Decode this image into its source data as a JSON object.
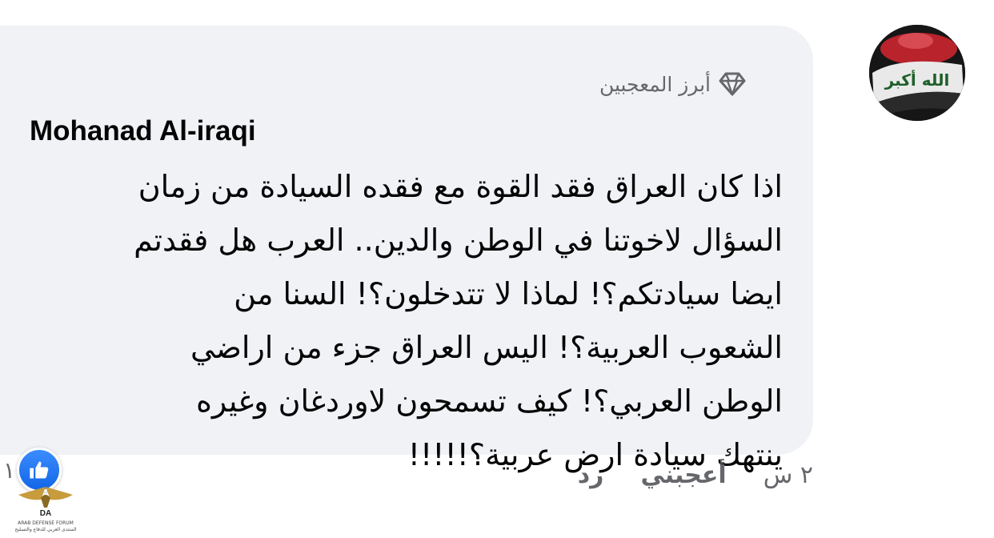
{
  "comment": {
    "top_fan_label": "أبرز المعجبين",
    "author": "Mohanad Al-iraqi",
    "text": "اذا كان العراق فقد القوة مع فقده السيادة من زمان\nالسؤال لاخوتنا في الوطن والدين.. العرب هل فقدتم\nايضا سيادتكم؟! لماذا لا تتدخلون؟! السنا من\nالشعوب العربية؟! اليس العراق جزء من اراضي\nالوطن العربي؟! كيف تسمحون لاوردغان وغيره\nينتهك سيادة ارض عربية؟!!!!!",
    "timestamp": "٢ س",
    "like_label": "أعجبني",
    "reply_label": "رد",
    "reaction_count": "١",
    "avatar_text": "الله أكبر"
  },
  "watermark": {
    "logo_text": "DA",
    "line1": "ARAB DEFENSE FORUM",
    "line2": "المنتدى العربي للدفاع والتسليح"
  },
  "colors": {
    "bubble": "#f0f2f5",
    "secondary_text": "#65676b",
    "like_blue": "#1877f2"
  },
  "icons": [
    "diamond-icon",
    "like-thumb-icon",
    "avatar-image"
  ]
}
